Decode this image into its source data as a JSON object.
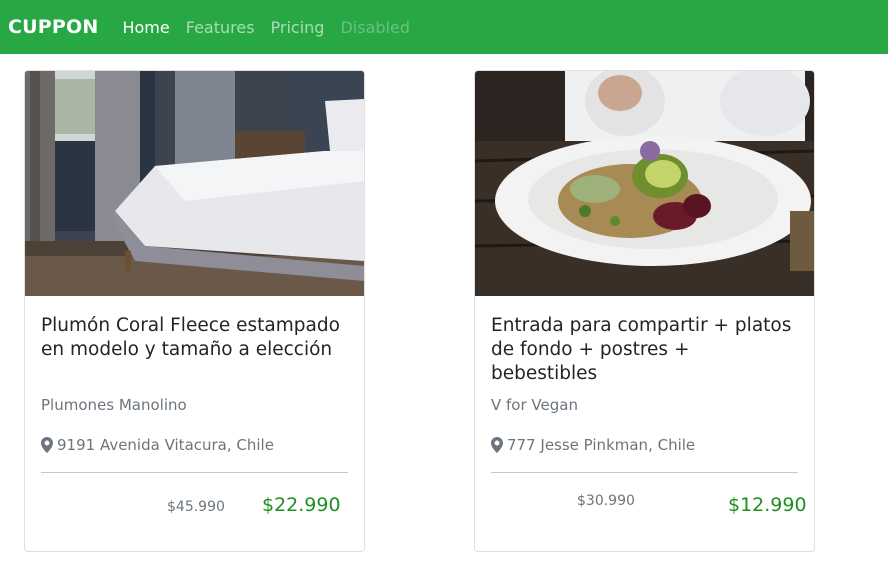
{
  "navbar": {
    "brand": "CUPPON",
    "links": [
      {
        "label": "Home",
        "state": "active"
      },
      {
        "label": "Features",
        "state": "normal"
      },
      {
        "label": "Pricing",
        "state": "normal"
      },
      {
        "label": "Disabled",
        "state": "disabled"
      }
    ]
  },
  "colors": {
    "navbar_bg": "#28a745",
    "price_green": "#1e8f1e",
    "muted_text": "#6c757d"
  },
  "deals": [
    {
      "image_icon": "bedroom-photo",
      "title": "Plumón Coral Fleece estampado en modelo y tamaño a elección",
      "merchant": "Plumones Manolino",
      "location_icon": "map-marker-icon",
      "address": "9191 Avenida Vitacura, Chile",
      "old_price": "$45.990",
      "new_price": "$22.990"
    },
    {
      "image_icon": "salad-plate-photo",
      "title": "Entrada para compartir + platos de fondo + postres + bebestibles",
      "merchant": "V for Vegan",
      "location_icon": "map-marker-icon",
      "address": "777 Jesse Pinkman, Chile",
      "old_price": "$30.990",
      "new_price": "$12.990"
    }
  ]
}
